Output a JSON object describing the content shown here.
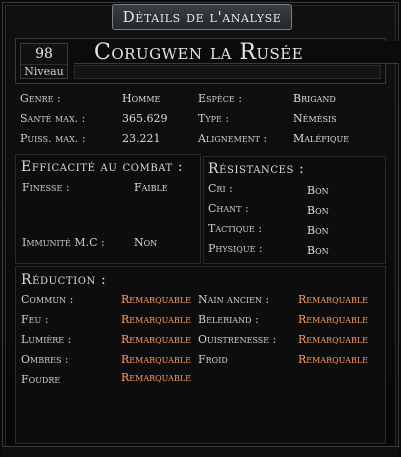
{
  "window": {
    "title": "Détails de l'analyse"
  },
  "header": {
    "level_value": "98",
    "level_label": "Niveau",
    "name": "Corugwen la Rusée"
  },
  "stats": {
    "left": [
      {
        "label": "Genre :",
        "value": "Homme"
      },
      {
        "label": "Santé max. :",
        "value": "365.629"
      },
      {
        "label": "Puiss. max. :",
        "value": "23.221"
      }
    ],
    "right": [
      {
        "label": "Espèce :",
        "value": "Brigand"
      },
      {
        "label": "Type :",
        "value": "Némésis"
      },
      {
        "label": "Alignement :",
        "value": "Maléfique"
      }
    ]
  },
  "combat": {
    "title": "Efficacité au combat :",
    "rows": [
      {
        "label": "Finesse :",
        "value": "Faible"
      },
      {
        "label": "Immunité M.C :",
        "value": "Non"
      }
    ]
  },
  "resistances": {
    "title": "Résistances :",
    "rows": [
      {
        "label": "Cri :",
        "value": "Bon"
      },
      {
        "label": "Chant :",
        "value": "Bon"
      },
      {
        "label": "Tactique :",
        "value": "Bon"
      },
      {
        "label": "Physique :",
        "value": "Bon"
      }
    ]
  },
  "reduction": {
    "title": "Réduction :",
    "left": [
      {
        "label": "Commun :",
        "value": "Remarquable"
      },
      {
        "label": "Feu :",
        "value": "Remarquable"
      },
      {
        "label": "Lumière :",
        "value": "Remarquable"
      },
      {
        "label": "Ombres :",
        "value": "Remarquable"
      },
      {
        "label": "Foudre",
        "value": "Remarquable"
      }
    ],
    "right": [
      {
        "label": "Nain ancien :",
        "value": "Remarquable"
      },
      {
        "label": "Beleriand :",
        "value": "Remarquable"
      },
      {
        "label": "Ouistrenesse :",
        "value": "Remarquable"
      },
      {
        "label": "Froid",
        "value": "Remarquable"
      }
    ]
  },
  "colors": {
    "accent_orange": "#ff9a63",
    "text": "#dcdcdc",
    "background": "#0a0a0a"
  }
}
